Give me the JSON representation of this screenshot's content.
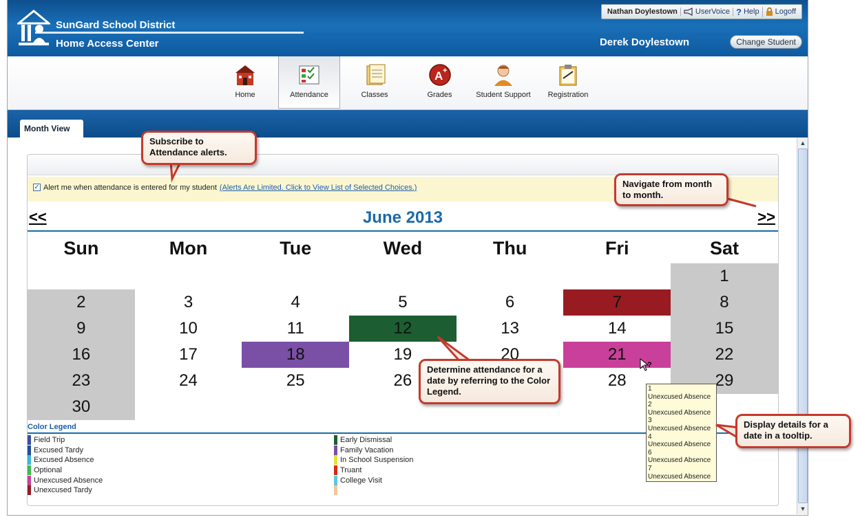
{
  "header": {
    "district_name": "SunGard School District",
    "portal_name": "Home Access Center",
    "user_name": "Nathan Doylestown",
    "uservoice_label": "UserVoice",
    "help_label": "Help",
    "logoff_label": "Logoff",
    "student_name": "Derek Doylestown",
    "change_student_label": "Change Student"
  },
  "nav": {
    "items": [
      {
        "label": "Home",
        "icon": "schoolhouse-icon"
      },
      {
        "label": "Attendance",
        "icon": "attendance-chart-icon"
      },
      {
        "label": "Classes",
        "icon": "notebook-icon"
      },
      {
        "label": "Grades",
        "icon": "a-plus-icon"
      },
      {
        "label": "Student Support",
        "icon": "person-icon"
      },
      {
        "label": "Registration",
        "icon": "clipboard-icon"
      }
    ],
    "active": "Attendance"
  },
  "tabs": {
    "month_view": "Month View"
  },
  "alert": {
    "checked": true,
    "label": "Alert me when attendance is entered for my student",
    "link": "(Alerts Are Limited. Click to View List of Selected Choices.)"
  },
  "calendar": {
    "prev_label": "<<",
    "next_label": ">>",
    "month_title": "June 2013",
    "weekdays": [
      "Sun",
      "Mon",
      "Tue",
      "Wed",
      "Thu",
      "Fri",
      "Sat"
    ],
    "weeks": [
      [
        "",
        "",
        "",
        "",
        "",
        "",
        "1"
      ],
      [
        "2",
        "3",
        "4",
        "5",
        "6",
        "7",
        "8"
      ],
      [
        "9",
        "10",
        "11",
        "12",
        "13",
        "14",
        "15"
      ],
      [
        "16",
        "17",
        "18",
        "19",
        "20",
        "21",
        "22"
      ],
      [
        "23",
        "24",
        "25",
        "26",
        "",
        "28",
        "29"
      ],
      [
        "30",
        "",
        "",
        "",
        "",
        "",
        ""
      ]
    ],
    "weekend_color": "#c9c9c9",
    "highlights": [
      {
        "day": "7",
        "color": "#981b22"
      },
      {
        "day": "12",
        "color": "#1c5e31"
      },
      {
        "day": "18",
        "color": "#7a4fa6"
      },
      {
        "day": "21",
        "color": "#c8409a"
      }
    ]
  },
  "legend": {
    "title": "Color Legend",
    "left": [
      {
        "label": "Field Trip",
        "color": "#3b4fa3"
      },
      {
        "label": "Excused Tardy",
        "color": "#1f4f9a"
      },
      {
        "label": "Excused Absence",
        "color": "#3fb7d8"
      },
      {
        "label": "Optional",
        "color": "#3cbc4a"
      },
      {
        "label": "Unexcused Absence",
        "color": "#c8409a"
      },
      {
        "label": "Unexcused Tardy",
        "color": "#981b22"
      }
    ],
    "right": [
      {
        "label": "Early Dismissal",
        "color": "#1c5e31"
      },
      {
        "label": "Family Vacation",
        "color": "#7a4fa6"
      },
      {
        "label": "In School Suspension",
        "color": "#e8e03a"
      },
      {
        "label": "Truant",
        "color": "#d42a1c"
      },
      {
        "label": "College Visit",
        "color": "#5ac8e0"
      },
      {
        "label": "",
        "color": "#f4c59a"
      }
    ]
  },
  "tooltip": {
    "lines": [
      "1",
      "Unexcused Absence",
      "2",
      "Unexcused Absence",
      "3",
      "Unexcused Absence",
      "4",
      "Unexcused Absence",
      "6",
      "Unexcused Absence",
      "7",
      "Unexcused Absence"
    ]
  },
  "callouts": {
    "subscribe": "Subscribe to Attendance alerts.",
    "navigate": "Navigate from month to month.",
    "determine": "Determine attendance for a date by referring to the Color Legend.",
    "tooltip": "Display details for a date in a tooltip."
  }
}
